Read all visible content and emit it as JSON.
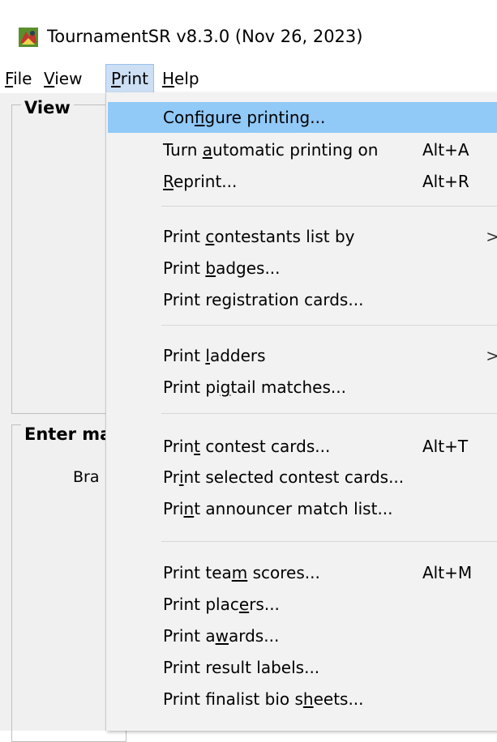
{
  "window": {
    "title": "TournamentSR v8.3.0 (Nov 26, 2023)",
    "icon": "tournament-app-icon"
  },
  "menubar": {
    "file": {
      "pre": "",
      "u": "F",
      "post": "ile"
    },
    "view": {
      "pre": "",
      "u": "V",
      "post": "iew"
    },
    "print": {
      "pre": "",
      "u": "P",
      "post": "rint"
    },
    "help": {
      "pre": "",
      "u": "H",
      "post": "elp"
    }
  },
  "main": {
    "view_group_label": "View",
    "enter_group_label": "Enter ma",
    "bra_label": "Bra"
  },
  "print_menu": {
    "items": [
      {
        "pre": "Con",
        "u": "f",
        "post": "igure printing...",
        "shortcut": "",
        "submenu": ""
      },
      {
        "pre": "Turn ",
        "u": "a",
        "post": "utomatic printing on",
        "shortcut": "Alt+A",
        "submenu": ""
      },
      {
        "pre": "",
        "u": "R",
        "post": "eprint...",
        "shortcut": "Alt+R",
        "submenu": ""
      },
      {
        "pre": "Print ",
        "u": "c",
        "post": "ontestants list by",
        "shortcut": "",
        "submenu": ">"
      },
      {
        "pre": "Print ",
        "u": "b",
        "post": "adges...",
        "shortcut": "",
        "submenu": ""
      },
      {
        "pre": "Print registration cards...",
        "u": "",
        "post": "",
        "shortcut": "",
        "submenu": ""
      },
      {
        "pre": "Print ",
        "u": "l",
        "post": "adders",
        "shortcut": "",
        "submenu": ">"
      },
      {
        "pre": "Print pi",
        "u": "g",
        "post": "tail matches...",
        "shortcut": "",
        "submenu": ""
      },
      {
        "pre": "Prin",
        "u": "t",
        "post": " contest cards...",
        "shortcut": "Alt+T",
        "submenu": ""
      },
      {
        "pre": "Pr",
        "u": "i",
        "post": "nt selected contest cards...",
        "shortcut": "",
        "submenu": ""
      },
      {
        "pre": "Pri",
        "u": "n",
        "post": "t announcer match list...",
        "shortcut": "",
        "submenu": ""
      },
      {
        "pre": "Print tea",
        "u": "m",
        "post": " scores...",
        "shortcut": "Alt+M",
        "submenu": ""
      },
      {
        "pre": "Print plac",
        "u": "e",
        "post": "rs...",
        "shortcut": "",
        "submenu": ""
      },
      {
        "pre": "Print a",
        "u": "w",
        "post": "ards...",
        "shortcut": "",
        "submenu": ""
      },
      {
        "pre": "Print result labels...",
        "u": "",
        "post": "",
        "shortcut": "",
        "submenu": ""
      },
      {
        "pre": "Print finalist bio s",
        "u": "h",
        "post": "eets...",
        "shortcut": "",
        "submenu": ""
      }
    ]
  },
  "colors": {
    "highlight": "#91c9f7",
    "menu_active": "#ccdff4",
    "menu_bg": "#f2f2f2"
  }
}
